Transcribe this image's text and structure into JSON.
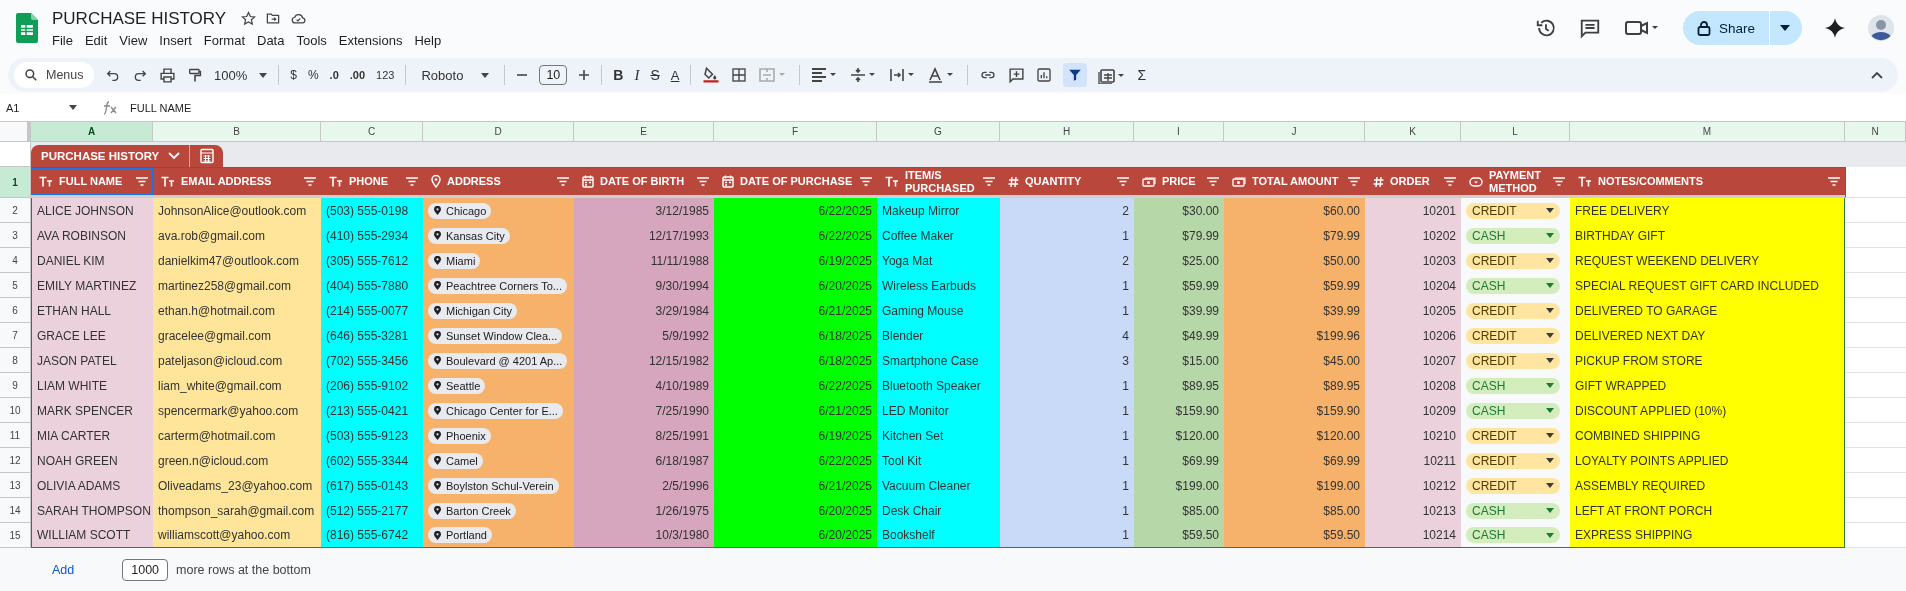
{
  "document": {
    "title": "PURCHASE HISTORY",
    "menus": [
      "File",
      "Edit",
      "View",
      "Insert",
      "Format",
      "Data",
      "Tools",
      "Extensions",
      "Help"
    ],
    "share_label": "Share"
  },
  "toolbar": {
    "search_placeholder": "Menus",
    "zoom": "100%",
    "currency": "$",
    "percent": "%",
    "decrease_decimals": ".0",
    "increase_decimals": ".00",
    "number_format": "123",
    "font": "Roboto",
    "font_size": "10",
    "bold": "B",
    "italic": "I",
    "strike": "S",
    "text_color": "A",
    "sum": "Σ",
    "filter_selected": true
  },
  "formula_bar": {
    "cell": "A1",
    "value": "FULL NAME"
  },
  "column_letters": [
    {
      "label": "A",
      "selected": true
    },
    {
      "label": "B",
      "selected": false
    },
    {
      "label": "C",
      "selected": false
    },
    {
      "label": "D",
      "selected": false
    },
    {
      "label": "E",
      "selected": false
    },
    {
      "label": "F",
      "selected": false
    },
    {
      "label": "G",
      "selected": false
    },
    {
      "label": "H",
      "selected": false
    },
    {
      "label": "I",
      "selected": false
    },
    {
      "label": "J",
      "selected": false
    },
    {
      "label": "K",
      "selected": false
    },
    {
      "label": "L",
      "selected": false
    },
    {
      "label": "M",
      "selected": false
    },
    {
      "label": "N",
      "selected": false
    }
  ],
  "table": {
    "name": "PURCHASE HISTORY",
    "header_row_number": "1",
    "columns": [
      {
        "header": "FULL NAME",
        "kind": "text",
        "color": "#ead1dc",
        "selected": true
      },
      {
        "header": "EMAIL ADDRESS",
        "kind": "text",
        "color": "#ffe599",
        "selected": false
      },
      {
        "header": "PHONE",
        "kind": "text",
        "color": "#00ffff",
        "selected": false
      },
      {
        "header": "ADDRESS",
        "kind": "location",
        "color": "#f6b26b",
        "selected": false
      },
      {
        "header": "DATE OF BIRTH",
        "kind": "date",
        "color": "#d5a6bd",
        "selected": false
      },
      {
        "header": "DATE OF PURCHASE",
        "kind": "date",
        "color": "#00ff00",
        "selected": false
      },
      {
        "header": "ITEM/S PURCHASED",
        "kind": "text",
        "color": "#00ffff",
        "selected": false
      },
      {
        "header": "QUANTITY",
        "kind": "number",
        "color": "#c9daf8",
        "selected": false
      },
      {
        "header": "PRICE",
        "kind": "currency",
        "color": "#b6d7a8",
        "selected": false
      },
      {
        "header": "TOTAL AMOUNT",
        "kind": "currency",
        "color": "#f6b26b",
        "selected": false
      },
      {
        "header": "ORDER",
        "kind": "number",
        "color": "#ead1dc",
        "selected": false
      },
      {
        "header": "PAYMENT METHOD",
        "kind": "choice",
        "color": "#f8f9fa",
        "selected": false
      },
      {
        "header": "NOTES/COMMENTS",
        "kind": "text",
        "color": "#ffff00",
        "selected": false
      }
    ],
    "rows": [
      {
        "number": "2",
        "cells": [
          "ALICE JOHNSON",
          "JohnsonAlice@outlook.com",
          "(503) 555-0198",
          "Chicago",
          "3/12/1985",
          "6/22/2025",
          "Makeup Mirror",
          "2",
          "$30.00",
          "$60.00",
          "10201",
          {
            "label": "CREDIT",
            "color": "#ffe5a0"
          },
          "FREE DELIVERY"
        ]
      },
      {
        "number": "3",
        "cells": [
          "AVA ROBINSON",
          "ava.rob@gmail.com",
          "(410) 555-2934",
          "Kansas City",
          "12/17/1993",
          "6/22/2025",
          "Coffee Maker",
          "1",
          "$79.99",
          "$79.99",
          "10202",
          {
            "label": "CASH",
            "color": "#d4edbc"
          },
          "BIRTHDAY GIFT"
        ]
      },
      {
        "number": "4",
        "cells": [
          "DANIEL KIM",
          "danielkim47@outlook.com",
          "(305) 555-7612",
          "Miami",
          "11/11/1988",
          "6/19/2025",
          "Yoga Mat",
          "2",
          "$25.00",
          "$50.00",
          "10203",
          {
            "label": "CREDIT",
            "color": "#ffe5a0"
          },
          "REQUEST WEEKEND DELIVERY"
        ]
      },
      {
        "number": "5",
        "cells": [
          "EMILY MARTINEZ",
          "martinez258@gmail.com",
          "(404) 555-7880",
          "Peachtree Corners To...",
          "9/30/1994",
          "6/20/2025",
          "Wireless Earbuds",
          "1",
          "$59.99",
          "$59.99",
          "10204",
          {
            "label": "CASH",
            "color": "#d4edbc"
          },
          "SPECIAL REQUEST GIFT CARD INCLUDED"
        ]
      },
      {
        "number": "6",
        "cells": [
          "ETHAN HALL",
          "ethan.h@hotmail.com",
          "(214) 555-0077",
          "Michigan City",
          "3/29/1984",
          "6/21/2025",
          "Gaming Mouse",
          "1",
          "$39.99",
          "$39.99",
          "10205",
          {
            "label": "CREDIT",
            "color": "#ffe5a0"
          },
          "DELIVERED TO GARAGE"
        ]
      },
      {
        "number": "7",
        "cells": [
          "GRACE LEE",
          "gracelee@gmail.com",
          "(646) 555-3281",
          "Sunset Window Clea...",
          "5/9/1992",
          "6/18/2025",
          "Blender",
          "4",
          "$49.99",
          "$199.96",
          "10206",
          {
            "label": "CREDIT",
            "color": "#ffe5a0"
          },
          "DELIVERED NEXT DAY"
        ]
      },
      {
        "number": "8",
        "cells": [
          "JASON PATEL",
          "pateljason@icloud.com",
          "(702) 555-3456",
          "Boulevard @ 4201 Ap...",
          "12/15/1982",
          "6/18/2025",
          "Smartphone Case",
          "3",
          "$15.00",
          "$45.00",
          "10207",
          {
            "label": "CREDIT",
            "color": "#ffe5a0"
          },
          "PICKUP FROM STORE"
        ]
      },
      {
        "number": "9",
        "cells": [
          "LIAM WHITE",
          "liam_white@gmail.com",
          "(206) 555-9102",
          "Seattle",
          "4/10/1989",
          "6/22/2025",
          "Bluetooth Speaker",
          "1",
          "$89.95",
          "$89.95",
          "10208",
          {
            "label": "CASH",
            "color": "#d4edbc"
          },
          "GIFT WRAPPED"
        ]
      },
      {
        "number": "10",
        "cells": [
          "MARK SPENCER",
          "spencermark@yahoo.com",
          "(213) 555-0421",
          "Chicago Center for E...",
          "7/25/1990",
          "6/21/2025",
          "LED Monitor",
          "1",
          "$159.90",
          "$159.90",
          "10209",
          {
            "label": "CASH",
            "color": "#d4edbc"
          },
          "DISCOUNT APPLIED (10%)"
        ]
      },
      {
        "number": "11",
        "cells": [
          "MIA CARTER",
          "carterm@hotmail.com",
          "(503) 555-9123",
          "Phoenix",
          "8/25/1991",
          "6/19/2025",
          "Kitchen Set",
          "1",
          "$120.00",
          "$120.00",
          "10210",
          {
            "label": "CREDIT",
            "color": "#ffe5a0"
          },
          "COMBINED SHIPPING"
        ]
      },
      {
        "number": "12",
        "cells": [
          "NOAH GREEN",
          "green.n@icloud.com",
          "(602) 555-3344",
          "Camel",
          "6/18/1987",
          "6/22/2025",
          "Tool Kit",
          "1",
          "$69.99",
          "$69.99",
          "10211",
          {
            "label": "CREDIT",
            "color": "#ffe5a0"
          },
          "LOYALTY POINTS APPLIED"
        ]
      },
      {
        "number": "13",
        "cells": [
          "OLIVIA ADAMS",
          "Oliveadams_23@yahoo.com",
          "(617) 555-0143",
          "Boylston Schul-Verein",
          "2/5/1996",
          "6/21/2025",
          "Vacuum Cleaner",
          "1",
          "$199.00",
          "$199.00",
          "10212",
          {
            "label": "CREDIT",
            "color": "#ffe5a0"
          },
          "ASSEMBLY REQUIRED"
        ]
      },
      {
        "number": "14",
        "cells": [
          "SARAH THOMPSON",
          "thompson_sarah@gmail.com",
          "(512) 555-2177",
          "Barton Creek",
          "1/26/1975",
          "6/20/2025",
          "Desk Chair",
          "1",
          "$85.00",
          "$85.00",
          "10213",
          {
            "label": "CASH",
            "color": "#d4edbc"
          },
          "LEFT AT FRONT PORCH"
        ]
      },
      {
        "number": "15",
        "cells": [
          "WILLIAM SCOTT",
          "williamscott@yahoo.com",
          "(816) 555-6742",
          "Portland",
          "10/3/1980",
          "6/20/2025",
          "Bookshelf",
          "1",
          "$59.50",
          "$59.50",
          "10214",
          {
            "label": "CASH",
            "color": "#d4edbc"
          },
          "EXPRESS SHIPPING"
        ]
      }
    ]
  },
  "footer": {
    "add_label": "Add",
    "row_count": "1000",
    "suffix": "more rows at the bottom"
  }
}
